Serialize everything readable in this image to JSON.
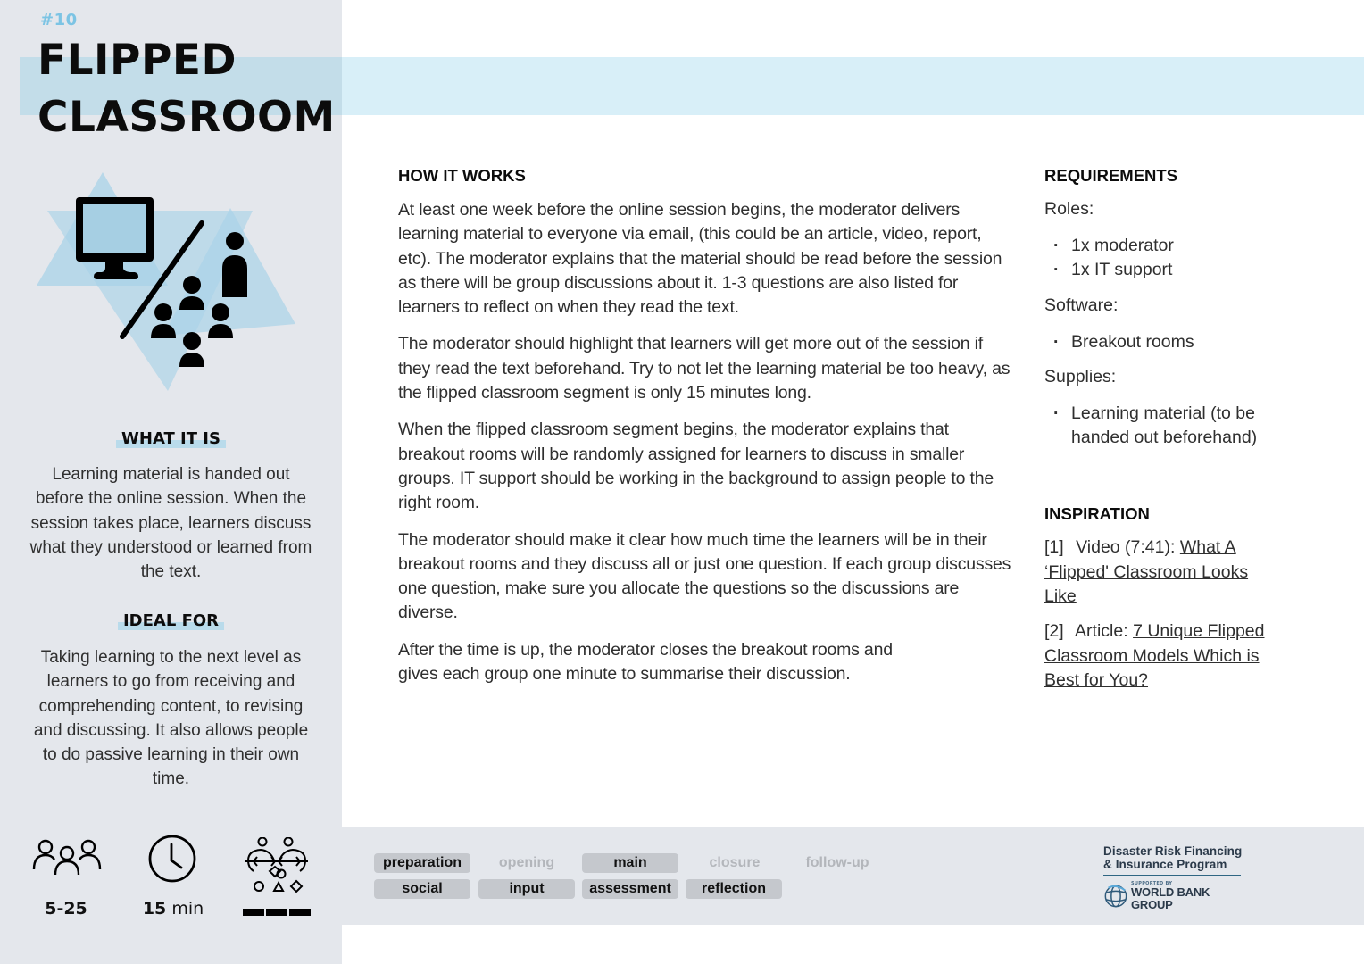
{
  "card": {
    "number": "#10",
    "title_line1": "FLIPPED",
    "title_line2": "CLASSROOM",
    "accent_color": "#7cc4e4",
    "band_color": "#d8eff8",
    "sidebar_color": "#e4e7ec"
  },
  "illustration": {
    "icons": [
      "monitor-icon",
      "divider-slash",
      "presenter-icon",
      "audience-icon"
    ]
  },
  "what_it_is": {
    "heading": "WHAT IT IS",
    "text": "Learning material is handed out before the online session. When the session takes place, learners discuss what they understood or learned from the text."
  },
  "ideal_for": {
    "heading": "IDEAL FOR",
    "text": "Taking learning to the next level as learners to go from receiving and comprehending content, to revising and discussing. It also allows people to do passive learning in their own time."
  },
  "stats": {
    "group_size": "5-25",
    "duration_value": "15",
    "duration_unit": "min",
    "interaction_level": 3,
    "interaction_level_max": 3,
    "icons": [
      "group-icon",
      "clock-icon",
      "interaction-icon"
    ]
  },
  "tags": {
    "row1": [
      {
        "label": "preparation",
        "active": true
      },
      {
        "label": "opening",
        "active": false
      },
      {
        "label": "main",
        "active": true
      },
      {
        "label": "closure",
        "active": false
      },
      {
        "label": "follow-up",
        "active": false
      }
    ],
    "row2": [
      {
        "label": "social",
        "active": true
      },
      {
        "label": "input",
        "active": true
      },
      {
        "label": "assessment",
        "active": true
      },
      {
        "label": "reflection",
        "active": true
      }
    ]
  },
  "logo": {
    "line1": "Disaster Risk Financing",
    "line2": "& Insurance Program",
    "supported_by": "SUPPORTED BY",
    "org": "WORLD BANK GROUP"
  },
  "how_it_works": {
    "heading": "HOW IT WORKS",
    "paragraphs": [
      "At least one week before the online session begins, the moderator delivers learning material to everyone via email, (this could be an article, video, report, etc). The moderator explains that the material should be read before the session as there will be group discussions about it. 1-3 questions are also listed for learners to reflect on when they read the text.",
      "The moderator should highlight that learners will get more out of the session if they read the text beforehand. Try to not let the learning material be too heavy, as the flipped classroom segment is only 15 minutes long.",
      "When the flipped classroom segment begins, the moderator explains that breakout rooms will be randomly assigned for learners to discuss in smaller groups. IT support should be working in the background to assign people to the right room.",
      "The moderator should make it clear how much time the learners will be in their breakout rooms and they discuss all or just one question. If each group discusses one question, make sure you allocate the questions so the discussions are diverse.",
      "After the time is up, the moderator closes the breakout rooms and gives each group one minute to summarise their discussion."
    ]
  },
  "requirements": {
    "heading": "REQUIREMENTS",
    "roles_label": "Roles:",
    "roles": [
      "1x moderator",
      "1x IT support"
    ],
    "software_label": "Software:",
    "software": [
      "Breakout rooms"
    ],
    "supplies_label": "Supplies:",
    "supplies": [
      "Learning material (to be handed out beforehand)"
    ]
  },
  "inspiration": {
    "heading": "INSPIRATION",
    "items": [
      {
        "num": "[1]",
        "type": "Video (7:41):",
        "link": "What A ‘Flipped' Classroom Looks Like"
      },
      {
        "num": "[2]",
        "type": "Article:",
        "link": "7 Unique Flipped Classroom Models Which is Best for You?"
      }
    ]
  }
}
